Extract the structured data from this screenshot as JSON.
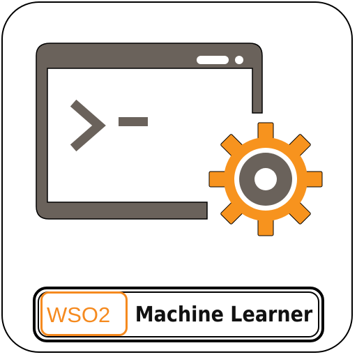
{
  "logo": {
    "text": "WSO2"
  },
  "product": {
    "name": "Machine Learner"
  },
  "colors": {
    "window_gray": "#6a625b",
    "gear_orange": "#f7931e",
    "logo_orange": "#f58a1f",
    "outline_black": "#000000"
  },
  "icons": [
    "terminal-window-icon",
    "prompt-chevron-icon",
    "gear-icon",
    "wso2-logo-icon"
  ]
}
